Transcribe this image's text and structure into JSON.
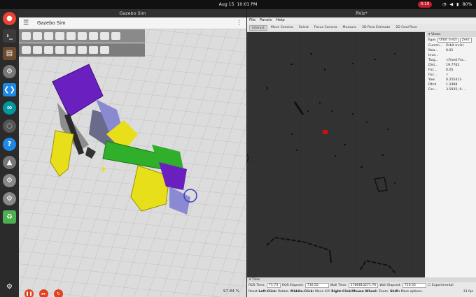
{
  "topbar": {
    "activities": "",
    "date": "Aug 15",
    "time": "10:01 PM",
    "recording": "0:19",
    "battery": "80%"
  },
  "dock": [
    {
      "name": "chrome-icon",
      "color": "#ea4335"
    },
    {
      "name": "terminal-icon",
      "color": "#3b3b3b"
    },
    {
      "name": "files-icon",
      "color": "#6b4a2e"
    },
    {
      "name": "settings-icon",
      "color": "#777777"
    },
    {
      "name": "vscode-icon",
      "color": "#1e88e5"
    },
    {
      "name": "arduino-icon",
      "color": "#00979d"
    },
    {
      "name": "ubuntu-icon",
      "color": "#555555"
    },
    {
      "name": "help-icon",
      "color": "#1e88e5"
    },
    {
      "name": "software-updater-icon",
      "color": "#777777"
    },
    {
      "name": "gear-icon",
      "color": "#888888"
    },
    {
      "name": "gear-icon-2",
      "color": "#888888"
    },
    {
      "name": "trash-icon",
      "color": "#4caf50"
    },
    {
      "name": "show-apps-icon",
      "color": "#2b2b2b"
    }
  ],
  "gazebo": {
    "window_title": "Gazebo Sim",
    "app_name": "Gazebo Sim",
    "zoom": "97.84 %"
  },
  "rviz": {
    "window_title": "RViz*",
    "menu": [
      "File",
      "Panels",
      "Help"
    ],
    "tools": [
      "Interact",
      "Move Camera",
      "Select",
      "Focus Camera",
      "Measure",
      "2D Pose Estimate",
      "2D Goal Pose"
    ],
    "views": {
      "header": "Views",
      "type_label": "Type:",
      "type_value": "Orbit (rviz)",
      "zero": "Zero",
      "current": "Curren...",
      "current_value": "Orbit (rviz)",
      "props": [
        {
          "k": "Nea...",
          "v": "0.01"
        },
        {
          "k": "Inve...",
          "v": ""
        },
        {
          "k": "Targ...",
          "v": "<Fixed Fra..."
        },
        {
          "k": "Dist...",
          "v": "19.7762"
        },
        {
          "k": "Foc...",
          "v": "0.05"
        },
        {
          "k": "Foc...",
          "v": "✓"
        },
        {
          "k": "Yaw",
          "v": "0.255413"
        },
        {
          "k": "Pitch",
          "v": "1.2498"
        },
        {
          "k": "Foc...",
          "v": "3.5935; 0...."
        }
      ],
      "buttons": [
        "Save",
        "Remove",
        "Rename"
      ]
    },
    "time": {
      "header": "Time",
      "ros_time_label": "ROS Time:",
      "ros_time": "71.73",
      "ros_elapsed_label": "ROS Elapsed:",
      "ros_elapsed": "716.55",
      "wall_time_label": "Wall Time:",
      "wall_time": "1786813271.76",
      "wall_elapsed_label": "Wall Elapsed:",
      "wall_elapsed": "716.55",
      "experimental": "Experimental"
    },
    "hint": {
      "reset": "Reset",
      "left": "Left-Click:",
      "left_v": "Rotate.",
      "middle": "Middle-Click:",
      "middle_v": "Move X/Y.",
      "right": "Right-Click/Mouse Wheel:",
      "right_v": "Zoom.",
      "shift": "Shift:",
      "shift_v": "More options.",
      "fps": "31 fps"
    }
  }
}
